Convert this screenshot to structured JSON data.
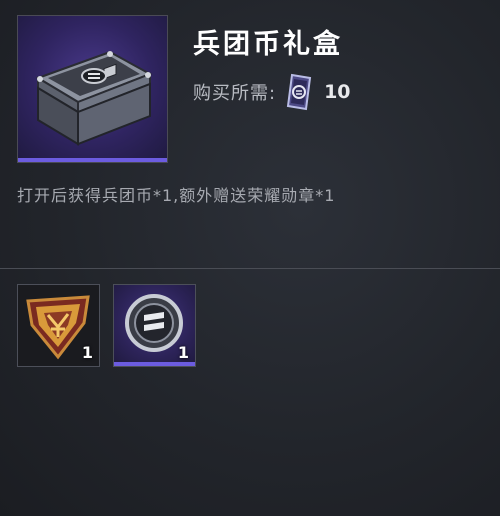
{
  "item": {
    "title": "兵团币礼盒",
    "price_label": "购买所需:",
    "price_icon": "honor-medal-card-icon",
    "price_value": "10",
    "description": "打开后获得兵团币*1,额外赠送荣耀勋章*1"
  },
  "rewards": [
    {
      "icon": "honor-medal-icon",
      "count": "1"
    },
    {
      "icon": "legion-coin-icon",
      "count": "1"
    }
  ],
  "colors": {
    "accent_purple": "#6c5ce0",
    "background": "#24272d",
    "title": "#ffffff",
    "secondary_text": "#a7aab1"
  }
}
